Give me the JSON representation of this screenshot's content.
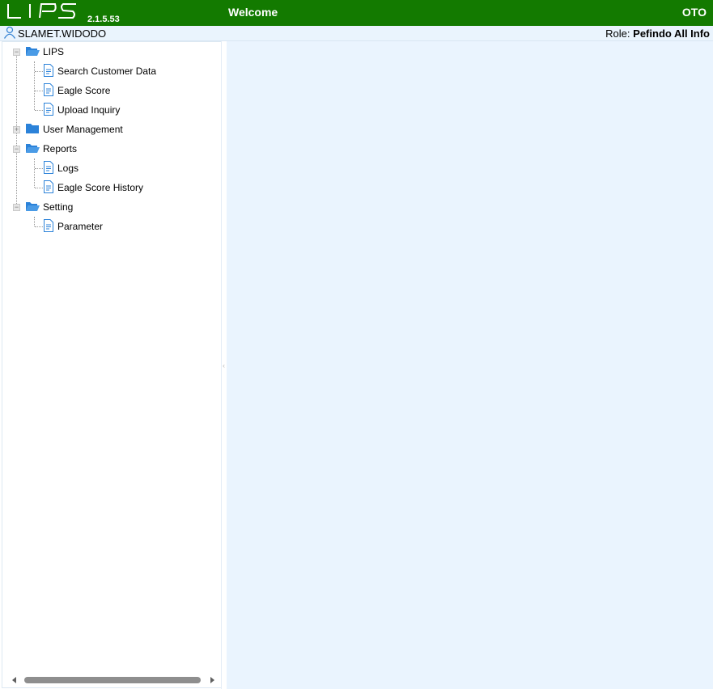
{
  "app": {
    "logo_text": "LIPS",
    "version": "2.1.5.53",
    "welcome": "Welcome",
    "environment": "OTO",
    "brand_color": "#137a00"
  },
  "user": {
    "icon": "user-icon",
    "name": "SLAMET.WIDODO",
    "role_label": "Role:",
    "role_value": "Pefindo All Info"
  },
  "tree": {
    "folder_color": "#2b82d9",
    "lips": {
      "label": "LIPS",
      "expanded": true,
      "items": [
        "Search Customer Data",
        "Eagle Score",
        "Upload Inquiry"
      ]
    },
    "user_management": {
      "label": "User Management",
      "expanded": false
    },
    "reports": {
      "label": "Reports",
      "expanded": true,
      "items": [
        "Logs",
        "Eagle Score History"
      ]
    },
    "setting": {
      "label": "Setting",
      "expanded": true,
      "items": [
        "Parameter"
      ]
    }
  }
}
